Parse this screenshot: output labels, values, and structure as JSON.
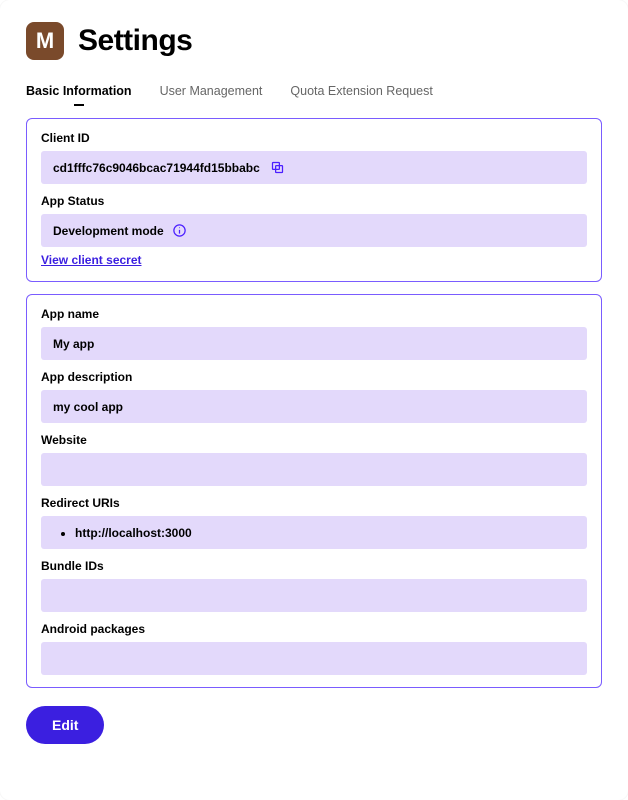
{
  "header": {
    "logo_letter": "M",
    "title": "Settings"
  },
  "tabs": {
    "items": [
      {
        "label": "Basic Information",
        "active": true
      },
      {
        "label": "User Management",
        "active": false
      },
      {
        "label": "Quota Extension Request",
        "active": false
      }
    ]
  },
  "credentials": {
    "client_id_label": "Client ID",
    "client_id_value": "cd1fffc76c9046bcac71944fd15bbabc",
    "app_status_label": "App Status",
    "app_status_value": "Development mode",
    "view_secret_label": "View client secret"
  },
  "details": {
    "app_name_label": "App name",
    "app_name_value": "My app",
    "app_desc_label": "App description",
    "app_desc_value": "my cool app",
    "website_label": "Website",
    "website_value": "",
    "redirect_label": "Redirect URIs",
    "redirect_uris": [
      "http://localhost:3000"
    ],
    "bundle_label": "Bundle IDs",
    "bundle_value": "",
    "android_label": "Android packages",
    "android_value": ""
  },
  "actions": {
    "edit_label": "Edit"
  }
}
